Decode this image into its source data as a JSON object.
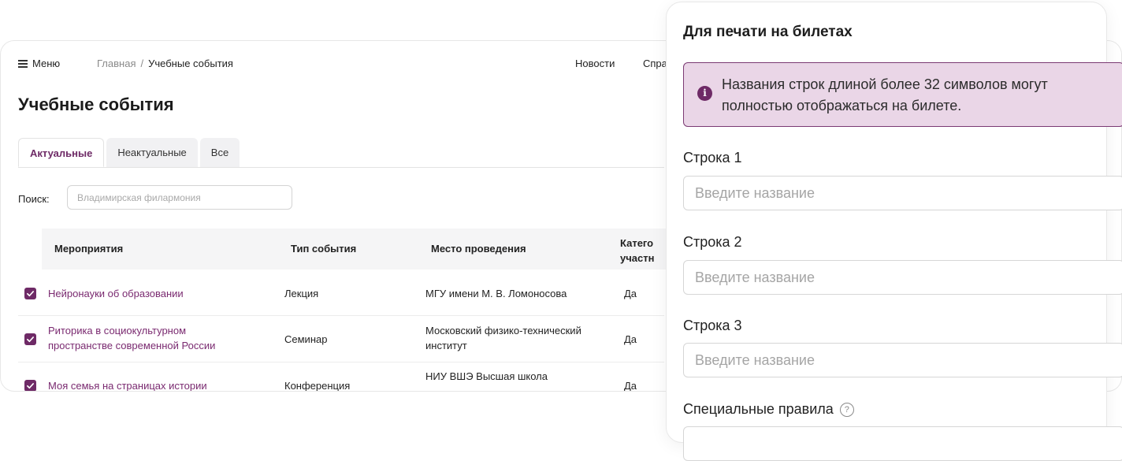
{
  "topbar": {
    "menu_label": "Меню",
    "breadcrumb": {
      "home": "Главная",
      "separator": "/",
      "current": "Учебные события"
    },
    "nav": {
      "news": "Новости",
      "help_truncated": "Спра"
    }
  },
  "page": {
    "title": "Учебные события"
  },
  "tabs": [
    {
      "label": "Актуальные",
      "active": true
    },
    {
      "label": "Неактуальные",
      "active": false
    },
    {
      "label": "Все",
      "active": false
    }
  ],
  "search": {
    "label": "Поиск:",
    "placeholder": "Владимирская филармония"
  },
  "table": {
    "columns": {
      "events": "Мероприятия",
      "type": "Тип события",
      "place": "Место проведения",
      "category_line1": "Катего",
      "category_line2": "участн"
    },
    "rows": [
      {
        "checked": true,
        "name": "Нейронауки об образовании",
        "type": "Лекция",
        "place": "МГУ имени М. В. Ломоносова",
        "category": "Да"
      },
      {
        "checked": true,
        "name_line1": "Риторика в социокультурном",
        "name_line2": "пространстве современной России",
        "type": "Семинар",
        "place_line1": "Московский физико-технический",
        "place_line2": "институт",
        "category": "Да"
      },
      {
        "checked": true,
        "name": "Моя семья на страницах истории",
        "type": "Конференция",
        "place_line1": "НИУ ВШЭ  Высшая  школа",
        "category": "Да"
      }
    ]
  },
  "panel": {
    "title": "Для печати на билетах",
    "alert_icon": "info-icon",
    "alert_line1": "Названия строк длиной более 32 символов могут",
    "alert_line2": "полностью отображаться на билете.",
    "fields": [
      {
        "label": "Строка 1",
        "placeholder": "Введите название"
      },
      {
        "label": "Строка 2",
        "placeholder": "Введите название"
      },
      {
        "label": "Строка 3",
        "placeholder": "Введите название"
      }
    ],
    "special_rules_label": "Специальные правила",
    "help_icon": "question-circle-icon"
  },
  "colors": {
    "accent": "#6e2a66",
    "alert_bg": "#ead6e7",
    "link": "#7a2a70"
  }
}
